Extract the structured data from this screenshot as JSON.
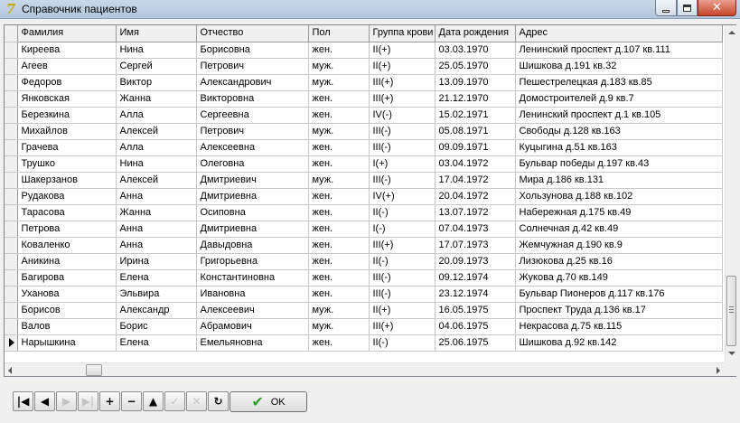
{
  "window": {
    "title": "Справочник пациентов",
    "icon": "app-icon",
    "min_glyph": "",
    "max_glyph": "",
    "close_glyph": "✕"
  },
  "grid": {
    "columns": [
      "Фамилия",
      "Имя",
      "Отчество",
      "Пол",
      "Группа крови",
      "Дата рождения",
      "Адрес"
    ],
    "current_row_index": 19,
    "rows": [
      [
        "Киреева",
        "Нина",
        "Борисовна",
        "жен.",
        "II(+)",
        "03.03.1970",
        "Ленинский проспект д.107 кв.111"
      ],
      [
        "Агеев",
        "Сергей",
        "Петрович",
        "муж.",
        "II(+)",
        "25.05.1970",
        "Шишкова д.191 кв.32"
      ],
      [
        "Федоров",
        "Виктор",
        "Александрович",
        "муж.",
        "III(+)",
        "13.09.1970",
        "Пешестрелецкая д.183 кв.85"
      ],
      [
        "Янковская",
        "Жанна",
        "Викторовна",
        "жен.",
        "III(+)",
        "21.12.1970",
        "Домостроителей д.9 кв.7"
      ],
      [
        "Березкина",
        "Алла",
        "Сергеевна",
        "жен.",
        "IV(-)",
        "15.02.1971",
        "Ленинский проспект д.1 кв.105"
      ],
      [
        "Михайлов",
        "Алексей",
        "Петрович",
        "муж.",
        "III(-)",
        "05.08.1971",
        "Свободы д.128 кв.163"
      ],
      [
        "Грачева",
        "Алла",
        "Алексеевна",
        "жен.",
        "III(-)",
        "09.09.1971",
        "Куцыгина д.51 кв.163"
      ],
      [
        "Трушко",
        "Нина",
        "Олеговна",
        "жен.",
        "I(+)",
        "03.04.1972",
        "Бульвар победы д.197 кв.43"
      ],
      [
        "Шакерзанов",
        "Алексей",
        "Дмитриевич",
        "муж.",
        "III(-)",
        "17.04.1972",
        "Мира д.186 кв.131"
      ],
      [
        "Рудакова",
        "Анна",
        "Дмитриевна",
        "жен.",
        "IV(+)",
        "20.04.1972",
        "Хользунова д.188 кв.102"
      ],
      [
        "Тарасова",
        "Жанна",
        "Осиповна",
        "жен.",
        "II(-)",
        "13.07.1972",
        "Набережная д.175 кв.49"
      ],
      [
        "Петрова",
        "Анна",
        "Дмитриевна",
        "жен.",
        "I(-)",
        "07.04.1973",
        "Солнечная д.42 кв.49"
      ],
      [
        "Коваленко",
        "Анна",
        "Давыдовна",
        "жен.",
        "III(+)",
        "17.07.1973",
        "Жемчужная д.190 кв.9"
      ],
      [
        "Аникина",
        "Ирина",
        "Григорьевна",
        "жен.",
        "II(-)",
        "20.09.1973",
        "Лизюкова д.25 кв.16"
      ],
      [
        "Багирова",
        "Елена",
        "Константиновна",
        "жен.",
        "III(-)",
        "09.12.1974",
        "Жукова д.70 кв.149"
      ],
      [
        "Уханова",
        "Эльвира",
        "Ивановна",
        "жен.",
        "III(-)",
        "23.12.1974",
        "Бульвар Пионеров д.117 кв.176"
      ],
      [
        "Борисов",
        "Александр",
        "Алексеевич",
        "муж.",
        "II(+)",
        "16.05.1975",
        "Проспект Труда д.136 кв.17"
      ],
      [
        "Валов",
        "Борис",
        "Абрамович",
        "муж.",
        "III(+)",
        "04.06.1975",
        "Некрасова д.75 кв.115"
      ],
      [
        "Нарышкина",
        "Елена",
        "Емельяновна",
        "жен.",
        "II(-)",
        "25.06.1975",
        "Шишкова д.92 кв.142"
      ]
    ]
  },
  "navigator": {
    "buttons": [
      {
        "name": "first-record-button",
        "glyph": "|◀",
        "enabled": true
      },
      {
        "name": "prior-record-button",
        "glyph": "◀",
        "enabled": true
      },
      {
        "name": "next-record-button",
        "glyph": "▶",
        "enabled": false
      },
      {
        "name": "last-record-button",
        "glyph": "▶|",
        "enabled": false
      },
      {
        "name": "insert-record-button",
        "glyph": "+",
        "enabled": true
      },
      {
        "name": "delete-record-button",
        "glyph": "−",
        "enabled": true
      },
      {
        "name": "edit-record-button",
        "glyph": "▲",
        "enabled": true
      },
      {
        "name": "post-edit-button",
        "glyph": "✓",
        "enabled": false
      },
      {
        "name": "cancel-edit-button",
        "glyph": "✕",
        "enabled": false
      },
      {
        "name": "refresh-button",
        "glyph": "↻",
        "enabled": true
      }
    ]
  },
  "ok_button": {
    "label": "OK",
    "icon": "check-icon",
    "check_glyph": "✔"
  },
  "colors": {
    "grid_lines": "#c8c8c8",
    "header_bg": "#f0f0f0",
    "ok_check": "#2aa02a"
  }
}
